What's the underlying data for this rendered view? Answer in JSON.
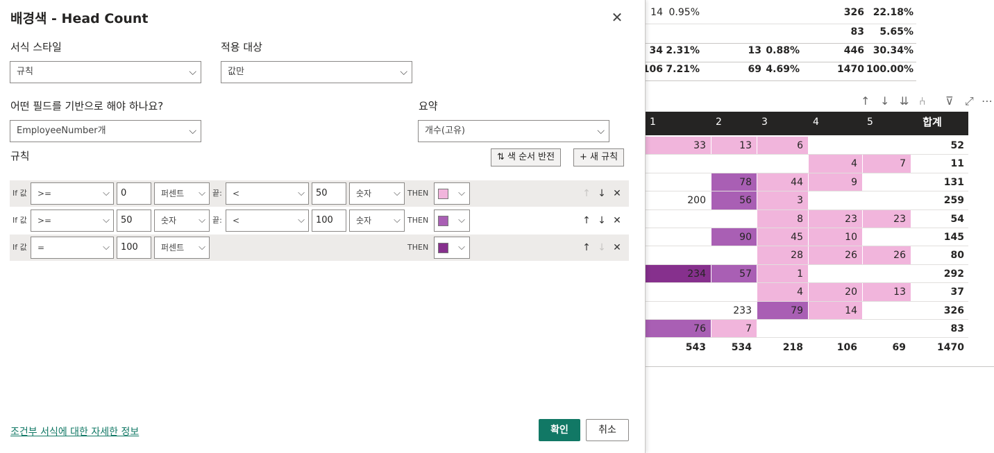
{
  "dialog": {
    "title": "배경색 - Head Count",
    "close_icon": "close-icon",
    "format_style_label": "서식 스타일",
    "format_style_value": "규칙",
    "apply_to_label": "적용 대상",
    "apply_to_value": "값만",
    "field_label": "어떤 필드를 기반으로 해야 하나요?",
    "field_value": "EmployeeNumber개",
    "summary_label": "요약",
    "summary_value": "개수(고유)",
    "rules_label": "규칙",
    "reverse_button": "⇅ 색 순서 반전",
    "new_rule_button": "+ 새 규칙",
    "rules": [
      {
        "if": "If 값",
        "op1": ">=",
        "v1": "0",
        "u1": "퍼센트",
        "and": "끝:",
        "op2": "<",
        "v2": "50",
        "u2": "숫자",
        "then": "THEN",
        "color": "#f1b5dc"
      },
      {
        "if": "If 값",
        "op1": ">=",
        "v1": "50",
        "u1": "숫자",
        "and": "끝:",
        "op2": "<",
        "v2": "100",
        "u2": "숫자",
        "then": "THEN",
        "color": "#a95fb4"
      },
      {
        "if": "If 값",
        "op1": "=",
        "v1": "100",
        "u1": "퍼센트",
        "then": "THEN",
        "color": "#86308d"
      }
    ],
    "learn_more_link": "조건부 서식에 대한 자세한 정보",
    "ok_button": "확인",
    "cancel_button": "취소"
  },
  "background": {
    "top_rows": [
      [
        "14",
        "0.95%",
        "",
        "",
        "326",
        "22.18%"
      ],
      [
        "",
        "",
        "",
        "",
        "83",
        "5.65%"
      ],
      [
        "34",
        "2.31%",
        "13",
        "0.88%",
        "446",
        "30.34%"
      ],
      [
        "106",
        "7.21%",
        "69",
        "4.69%",
        "1470",
        "100.00%"
      ]
    ],
    "matrix_headers": [
      "1",
      "2",
      "3",
      "4",
      "5",
      "합계"
    ],
    "matrix_rows": [
      [
        {
          "v": "33",
          "c": "#f1b5dc"
        },
        {
          "v": "13",
          "c": "#f1b5dc"
        },
        {
          "v": "6",
          "c": "#f1b5dc"
        },
        {
          "v": "",
          "c": ""
        },
        {
          "v": "",
          "c": ""
        },
        {
          "v": "52"
        }
      ],
      [
        {
          "v": "",
          "c": ""
        },
        {
          "v": "",
          "c": ""
        },
        {
          "v": "",
          "c": ""
        },
        {
          "v": "4",
          "c": "#f1b5dc"
        },
        {
          "v": "7",
          "c": "#f1b5dc"
        },
        {
          "v": "11"
        }
      ],
      [
        {
          "v": "",
          "c": ""
        },
        {
          "v": "78",
          "c": "#a95fb4"
        },
        {
          "v": "44",
          "c": "#f1b5dc"
        },
        {
          "v": "9",
          "c": "#f1b5dc"
        },
        {
          "v": "",
          "c": ""
        },
        {
          "v": "131"
        }
      ],
      [
        {
          "v": "200",
          "c": ""
        },
        {
          "v": "56",
          "c": "#a95fb4"
        },
        {
          "v": "3",
          "c": "#f1b5dc"
        },
        {
          "v": "",
          "c": ""
        },
        {
          "v": "",
          "c": ""
        },
        {
          "v": "259"
        }
      ],
      [
        {
          "v": "",
          "c": ""
        },
        {
          "v": "",
          "c": ""
        },
        {
          "v": "8",
          "c": "#f1b5dc"
        },
        {
          "v": "23",
          "c": "#f1b5dc"
        },
        {
          "v": "23",
          "c": "#f1b5dc"
        },
        {
          "v": "54"
        }
      ],
      [
        {
          "v": "",
          "c": ""
        },
        {
          "v": "90",
          "c": "#a95fb4"
        },
        {
          "v": "45",
          "c": "#f1b5dc"
        },
        {
          "v": "10",
          "c": "#f1b5dc"
        },
        {
          "v": "",
          "c": ""
        },
        {
          "v": "145"
        }
      ],
      [
        {
          "v": "",
          "c": ""
        },
        {
          "v": "",
          "c": ""
        },
        {
          "v": "28",
          "c": "#f1b5dc"
        },
        {
          "v": "26",
          "c": "#f1b5dc"
        },
        {
          "v": "26",
          "c": "#f1b5dc"
        },
        {
          "v": "80"
        }
      ],
      [
        {
          "v": "234",
          "c": "#86308d"
        },
        {
          "v": "57",
          "c": "#a95fb4"
        },
        {
          "v": "1",
          "c": "#f1b5dc"
        },
        {
          "v": "",
          "c": ""
        },
        {
          "v": "",
          "c": ""
        },
        {
          "v": "292"
        }
      ],
      [
        {
          "v": "",
          "c": ""
        },
        {
          "v": "",
          "c": ""
        },
        {
          "v": "4",
          "c": "#f1b5dc"
        },
        {
          "v": "20",
          "c": "#f1b5dc"
        },
        {
          "v": "13",
          "c": "#f1b5dc"
        },
        {
          "v": "37"
        }
      ],
      [
        {
          "v": "",
          "c": ""
        },
        {
          "v": "233",
          "c": ""
        },
        {
          "v": "79",
          "c": "#a95fb4"
        },
        {
          "v": "14",
          "c": "#f1b5dc"
        },
        {
          "v": "",
          "c": ""
        },
        {
          "v": "326"
        }
      ],
      [
        {
          "v": "76",
          "c": "#a95fb4"
        },
        {
          "v": "7",
          "c": "#f1b5dc"
        },
        {
          "v": "",
          "c": ""
        },
        {
          "v": "",
          "c": ""
        },
        {
          "v": "",
          "c": ""
        },
        {
          "v": "83"
        }
      ]
    ],
    "matrix_totals": [
      "543",
      "534",
      "218",
      "106",
      "69",
      "1470"
    ],
    "toolbar_icons": [
      "arrow-up-icon",
      "arrow-down-icon",
      "double-arrow-down-icon",
      "expand-hierarchy-icon",
      "filter-icon",
      "focus-mode-icon",
      "more-options-icon"
    ]
  }
}
